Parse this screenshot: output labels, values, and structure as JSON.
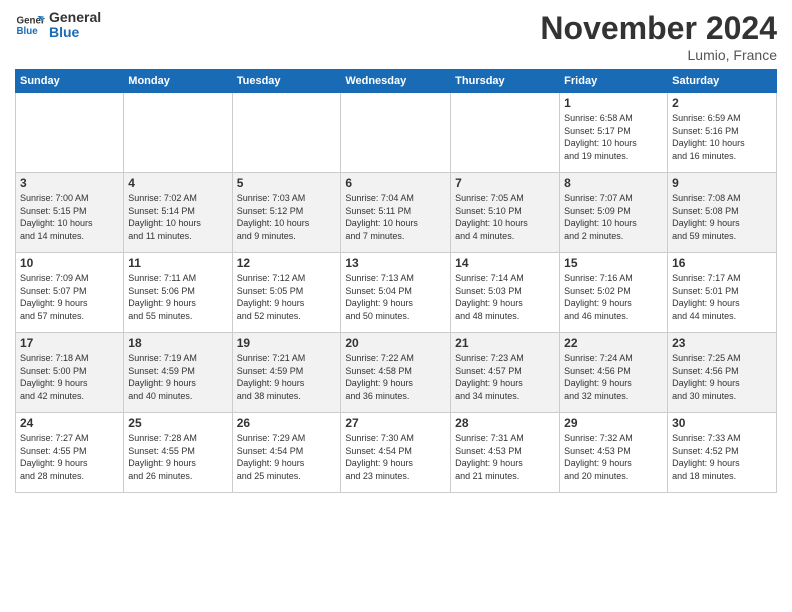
{
  "logo": {
    "line1": "General",
    "line2": "Blue"
  },
  "title": "November 2024",
  "subtitle": "Lumio, France",
  "days_of_week": [
    "Sunday",
    "Monday",
    "Tuesday",
    "Wednesday",
    "Thursday",
    "Friday",
    "Saturday"
  ],
  "weeks": [
    [
      {
        "day": "",
        "info": ""
      },
      {
        "day": "",
        "info": ""
      },
      {
        "day": "",
        "info": ""
      },
      {
        "day": "",
        "info": ""
      },
      {
        "day": "",
        "info": ""
      },
      {
        "day": "1",
        "info": "Sunrise: 6:58 AM\nSunset: 5:17 PM\nDaylight: 10 hours\nand 19 minutes."
      },
      {
        "day": "2",
        "info": "Sunrise: 6:59 AM\nSunset: 5:16 PM\nDaylight: 10 hours\nand 16 minutes."
      }
    ],
    [
      {
        "day": "3",
        "info": "Sunrise: 7:00 AM\nSunset: 5:15 PM\nDaylight: 10 hours\nand 14 minutes."
      },
      {
        "day": "4",
        "info": "Sunrise: 7:02 AM\nSunset: 5:14 PM\nDaylight: 10 hours\nand 11 minutes."
      },
      {
        "day": "5",
        "info": "Sunrise: 7:03 AM\nSunset: 5:12 PM\nDaylight: 10 hours\nand 9 minutes."
      },
      {
        "day": "6",
        "info": "Sunrise: 7:04 AM\nSunset: 5:11 PM\nDaylight: 10 hours\nand 7 minutes."
      },
      {
        "day": "7",
        "info": "Sunrise: 7:05 AM\nSunset: 5:10 PM\nDaylight: 10 hours\nand 4 minutes."
      },
      {
        "day": "8",
        "info": "Sunrise: 7:07 AM\nSunset: 5:09 PM\nDaylight: 10 hours\nand 2 minutes."
      },
      {
        "day": "9",
        "info": "Sunrise: 7:08 AM\nSunset: 5:08 PM\nDaylight: 9 hours\nand 59 minutes."
      }
    ],
    [
      {
        "day": "10",
        "info": "Sunrise: 7:09 AM\nSunset: 5:07 PM\nDaylight: 9 hours\nand 57 minutes."
      },
      {
        "day": "11",
        "info": "Sunrise: 7:11 AM\nSunset: 5:06 PM\nDaylight: 9 hours\nand 55 minutes."
      },
      {
        "day": "12",
        "info": "Sunrise: 7:12 AM\nSunset: 5:05 PM\nDaylight: 9 hours\nand 52 minutes."
      },
      {
        "day": "13",
        "info": "Sunrise: 7:13 AM\nSunset: 5:04 PM\nDaylight: 9 hours\nand 50 minutes."
      },
      {
        "day": "14",
        "info": "Sunrise: 7:14 AM\nSunset: 5:03 PM\nDaylight: 9 hours\nand 48 minutes."
      },
      {
        "day": "15",
        "info": "Sunrise: 7:16 AM\nSunset: 5:02 PM\nDaylight: 9 hours\nand 46 minutes."
      },
      {
        "day": "16",
        "info": "Sunrise: 7:17 AM\nSunset: 5:01 PM\nDaylight: 9 hours\nand 44 minutes."
      }
    ],
    [
      {
        "day": "17",
        "info": "Sunrise: 7:18 AM\nSunset: 5:00 PM\nDaylight: 9 hours\nand 42 minutes."
      },
      {
        "day": "18",
        "info": "Sunrise: 7:19 AM\nSunset: 4:59 PM\nDaylight: 9 hours\nand 40 minutes."
      },
      {
        "day": "19",
        "info": "Sunrise: 7:21 AM\nSunset: 4:59 PM\nDaylight: 9 hours\nand 38 minutes."
      },
      {
        "day": "20",
        "info": "Sunrise: 7:22 AM\nSunset: 4:58 PM\nDaylight: 9 hours\nand 36 minutes."
      },
      {
        "day": "21",
        "info": "Sunrise: 7:23 AM\nSunset: 4:57 PM\nDaylight: 9 hours\nand 34 minutes."
      },
      {
        "day": "22",
        "info": "Sunrise: 7:24 AM\nSunset: 4:56 PM\nDaylight: 9 hours\nand 32 minutes."
      },
      {
        "day": "23",
        "info": "Sunrise: 7:25 AM\nSunset: 4:56 PM\nDaylight: 9 hours\nand 30 minutes."
      }
    ],
    [
      {
        "day": "24",
        "info": "Sunrise: 7:27 AM\nSunset: 4:55 PM\nDaylight: 9 hours\nand 28 minutes."
      },
      {
        "day": "25",
        "info": "Sunrise: 7:28 AM\nSunset: 4:55 PM\nDaylight: 9 hours\nand 26 minutes."
      },
      {
        "day": "26",
        "info": "Sunrise: 7:29 AM\nSunset: 4:54 PM\nDaylight: 9 hours\nand 25 minutes."
      },
      {
        "day": "27",
        "info": "Sunrise: 7:30 AM\nSunset: 4:54 PM\nDaylight: 9 hours\nand 23 minutes."
      },
      {
        "day": "28",
        "info": "Sunrise: 7:31 AM\nSunset: 4:53 PM\nDaylight: 9 hours\nand 21 minutes."
      },
      {
        "day": "29",
        "info": "Sunrise: 7:32 AM\nSunset: 4:53 PM\nDaylight: 9 hours\nand 20 minutes."
      },
      {
        "day": "30",
        "info": "Sunrise: 7:33 AM\nSunset: 4:52 PM\nDaylight: 9 hours\nand 18 minutes."
      }
    ]
  ]
}
